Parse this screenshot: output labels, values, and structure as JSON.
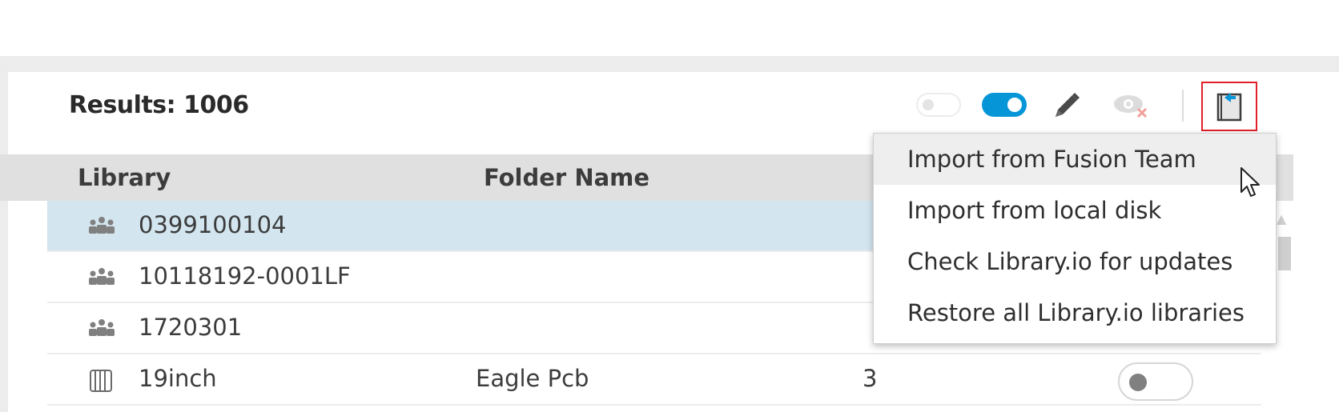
{
  "header": {
    "results_label": "Results: 1006"
  },
  "toolbar": {
    "show_toggle_state": "off",
    "filter_toggle_state": "on",
    "edit_icon": "pencil-icon",
    "hide_icon": "eye-hide-icon",
    "import_icon": "library-import-icon",
    "accent_color": "#0696d7",
    "highlight_border_color": "#e0202a"
  },
  "table": {
    "columns": [
      "Library",
      "Folder Name"
    ],
    "rows": [
      {
        "icon": "team-library-icon",
        "library": "0399100104",
        "folder": "",
        "count": "",
        "selected": true
      },
      {
        "icon": "team-library-icon",
        "library": "10118192-0001LF",
        "folder": "",
        "count": "",
        "selected": false
      },
      {
        "icon": "team-library-icon",
        "library": "1720301",
        "folder": "",
        "count": "",
        "selected": false
      },
      {
        "icon": "local-library-icon",
        "library": "19inch",
        "folder": "Eagle Pcb",
        "count": "3",
        "selected": false,
        "toggle": "off"
      }
    ]
  },
  "import_menu": {
    "items": [
      "Import from Fusion Team",
      "Import from local disk",
      "Check Library.io for updates",
      "Restore all Library.io libraries"
    ],
    "hovered_index": 0
  }
}
